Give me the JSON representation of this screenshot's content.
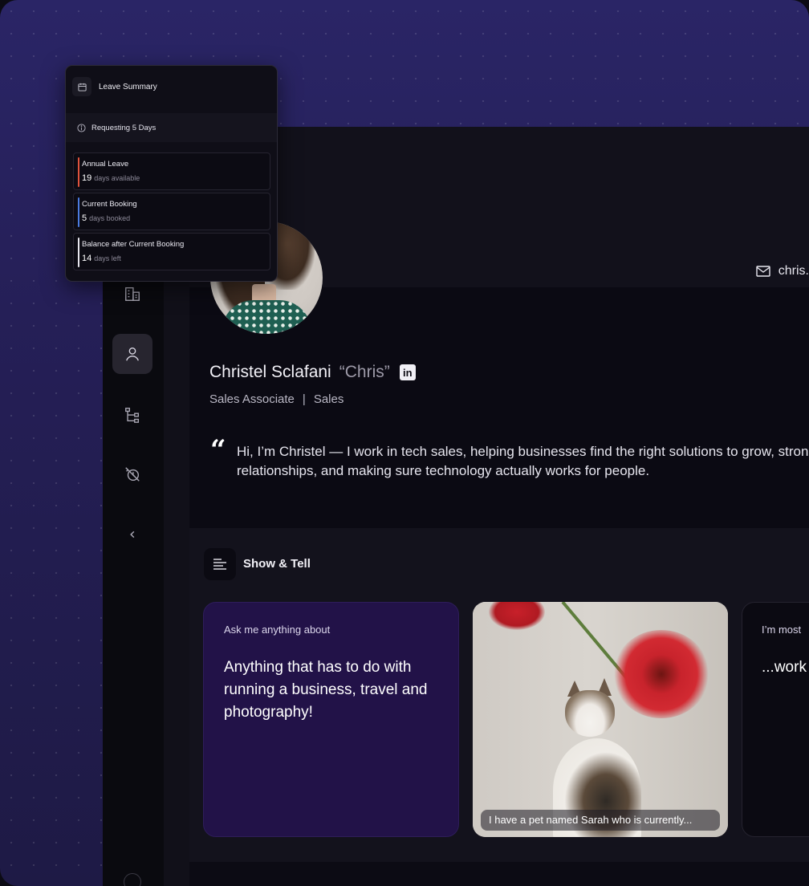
{
  "leave_summary": {
    "title": "Leave Summary",
    "requesting": "Requesting 5 Days",
    "rows": [
      {
        "label": "Annual Leave",
        "value": "19",
        "unit": "days available",
        "color": "#e0533d"
      },
      {
        "label": "Current Booking",
        "value": "5",
        "unit": "days booked",
        "color": "#4b7be0"
      },
      {
        "label": "Balance after Current Booking",
        "value": "14",
        "unit": "days left",
        "color": "#e8e7ef"
      }
    ]
  },
  "profile": {
    "email": "chris.s",
    "name": "Christel Sclafani",
    "nickname": "“Chris”",
    "linkedin": "in",
    "role": "Sales Associate",
    "separator": "|",
    "department": "Sales",
    "quote_mark": "“",
    "quote": "Hi, I’m Christel — I work in tech sales, helping businesses find the right solutions to grow, strong relationships, and making sure technology actually works for people."
  },
  "show_and_tell": {
    "title": "Show & Tell",
    "cards": [
      {
        "eyebrow": "Ask me anything about",
        "text": "Anything that has to do with running a business, travel and photography!"
      },
      {
        "caption": "I have a pet named Sarah who is currently..."
      },
      {
        "eyebrow": "I’m most",
        "text": "...work market the de busine"
      }
    ]
  },
  "nav": {
    "items": [
      "building",
      "profile",
      "org-chart",
      "time-off",
      "collapse"
    ],
    "active": "profile"
  },
  "colors": {
    "accent_purple": "#221248",
    "background_purple": "#2a2566",
    "annual_bar": "#e0533d",
    "booking_bar": "#4b7be0"
  }
}
